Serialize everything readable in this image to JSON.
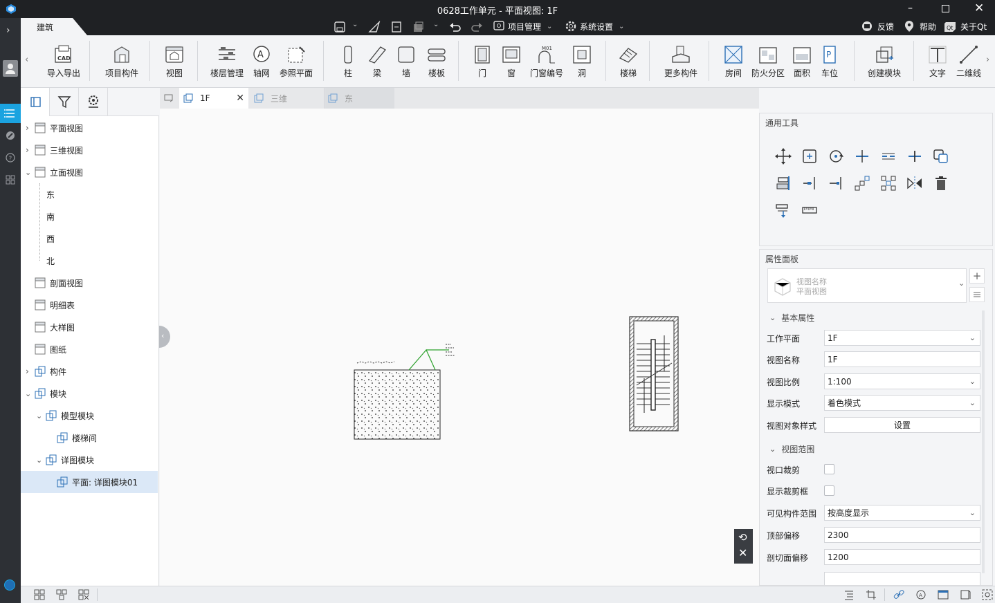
{
  "window": {
    "title": "0628工作单元 - 平面视图: 1F"
  },
  "top_tabs": {
    "active": "建筑"
  },
  "quick": {
    "project_mgmt": "项目管理",
    "system_settings": "系统设置",
    "feedback": "反馈",
    "help": "帮助",
    "about": "关于Qt"
  },
  "ribbon": {
    "import_export": "导入导出",
    "cad_badge": "CAD",
    "project_component": "项目构件",
    "view": "视图",
    "floor_mgmt": "楼层管理",
    "grid": "轴网",
    "ref_plane": "参照平面",
    "column": "柱",
    "beam": "梁",
    "wall": "墙",
    "slab": "楼板",
    "door": "门",
    "window": "窗",
    "door_window_number": "门窗编号",
    "m01_badge": "M01",
    "opening": "洞",
    "stair": "楼梯",
    "more_components": "更多构件",
    "room": "房间",
    "fire_zone": "防火分区",
    "area": "面积",
    "parking": "车位",
    "parking_badge": "P",
    "create_module": "创建模块",
    "text": "文字",
    "line2d": "二维线"
  },
  "tree": {
    "plan_views": "平面视图",
    "3d_views": "三维视图",
    "elevation_views": "立面视图",
    "east": "东",
    "south": "南",
    "west": "西",
    "north": "北",
    "section_views": "剖面视图",
    "schedule": "明细表",
    "detail_view": "大样图",
    "sheets": "图纸",
    "components": "构件",
    "modules": "模块",
    "model_modules": "模型模块",
    "stairwell": "楼梯间",
    "detail_modules": "详图模块",
    "detail_module01": "平面: 详图模块01"
  },
  "doc_tabs": {
    "tab1": "1F",
    "tab2": "三维",
    "tab3": "东"
  },
  "tools_panel": {
    "title": "通用工具"
  },
  "props": {
    "title": "属性面板",
    "view_name_label": "视图名称",
    "view_name_type": "平面视图",
    "basic_section": "基本属性",
    "work_plane_label": "工作平面",
    "work_plane_value": "1F",
    "view_name_field_label": "视图名称",
    "view_name_value": "1F",
    "scale_label": "视图比例",
    "scale_value": "1:100",
    "display_mode_label": "显示模式",
    "display_mode_value": "着色模式",
    "object_style_label": "视图对象样式",
    "object_style_button": "设置",
    "view_range_section": "视图范围",
    "crop_label": "视口裁剪",
    "show_crop_label": "显示裁剪框",
    "visible_range_label": "可见构件范围",
    "visible_range_value": "按高度显示",
    "top_offset_label": "顶部偏移",
    "top_offset_value": "2300",
    "cut_offset_label": "剖切面偏移",
    "cut_offset_value": "1200"
  },
  "colors": {
    "accent": "#1ba3e0",
    "titlebar": "#1f2124",
    "selection": "#dbe8f7"
  }
}
